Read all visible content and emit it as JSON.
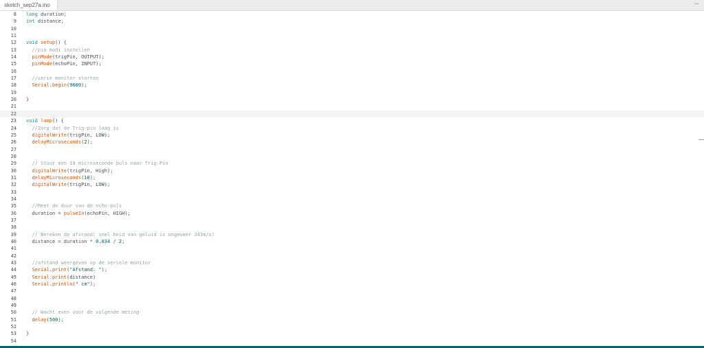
{
  "tab": {
    "filename": "sketch_sep27a.ino",
    "more_icon": "more-horizontal-icon",
    "more_glyph": "···"
  },
  "editor": {
    "current_line": 22,
    "lines": [
      {
        "n": "8",
        "t": [
          [
            "kw",
            "long"
          ],
          [
            "p",
            " duration;"
          ]
        ]
      },
      {
        "n": "9",
        "t": [
          [
            "kw",
            "int"
          ],
          [
            "p",
            " distance;"
          ]
        ]
      },
      {
        "n": "10",
        "t": []
      },
      {
        "n": "11",
        "t": []
      },
      {
        "n": "12",
        "t": [
          [
            "kw",
            "void"
          ],
          [
            "p",
            " "
          ],
          [
            "fn",
            "setup"
          ],
          [
            "p",
            "() {"
          ]
        ]
      },
      {
        "n": "13",
        "t": [
          [
            "p",
            "  "
          ],
          [
            "cm",
            "//pin modi instellen"
          ]
        ]
      },
      {
        "n": "14",
        "t": [
          [
            "p",
            "  "
          ],
          [
            "fn",
            "pinMode"
          ],
          [
            "p",
            "(trigPin, OUTPUT);"
          ]
        ]
      },
      {
        "n": "15",
        "t": [
          [
            "p",
            "  "
          ],
          [
            "fn",
            "pinMode"
          ],
          [
            "p",
            "(echoPin, INPUT);"
          ]
        ]
      },
      {
        "n": "16",
        "t": []
      },
      {
        "n": "17",
        "t": [
          [
            "p",
            "  "
          ],
          [
            "cm",
            "//serie monitor starten"
          ]
        ]
      },
      {
        "n": "18",
        "t": [
          [
            "p",
            "  "
          ],
          [
            "fn",
            "Serial"
          ],
          [
            "p",
            "."
          ],
          [
            "fn",
            "begin"
          ],
          [
            "p",
            "("
          ],
          [
            "num",
            "9600"
          ],
          [
            "p",
            ");"
          ]
        ]
      },
      {
        "n": "19",
        "t": []
      },
      {
        "n": "20",
        "t": [
          [
            "p",
            "}"
          ]
        ]
      },
      {
        "n": "21",
        "t": []
      },
      {
        "n": "22",
        "t": []
      },
      {
        "n": "23",
        "t": [
          [
            "kw",
            "void"
          ],
          [
            "p",
            " "
          ],
          [
            "fn",
            "loop"
          ],
          [
            "p",
            "() {"
          ]
        ]
      },
      {
        "n": "24",
        "t": [
          [
            "p",
            "  "
          ],
          [
            "cm",
            "//Zorg dat de Trig-pin laag is"
          ]
        ]
      },
      {
        "n": "25",
        "t": [
          [
            "p",
            "  "
          ],
          [
            "fn",
            "digitalWrite"
          ],
          [
            "p",
            "(trigPin, LOW);"
          ]
        ]
      },
      {
        "n": "26",
        "t": [
          [
            "p",
            "  "
          ],
          [
            "fn",
            "delayMicroseconds"
          ],
          [
            "p",
            "("
          ],
          [
            "num",
            "2"
          ],
          [
            "p",
            ");"
          ]
        ]
      },
      {
        "n": "27",
        "t": []
      },
      {
        "n": "28",
        "t": []
      },
      {
        "n": "29",
        "t": [
          [
            "p",
            "  "
          ],
          [
            "cm",
            "// Stuur een 10 microseconde puls naar Trig-Pin"
          ]
        ]
      },
      {
        "n": "30",
        "t": [
          [
            "p",
            "  "
          ],
          [
            "fn",
            "digitalWrite"
          ],
          [
            "p",
            "(trigPin, High);"
          ]
        ]
      },
      {
        "n": "31",
        "t": [
          [
            "p",
            "  "
          ],
          [
            "fn",
            "delayMicroseconds"
          ],
          [
            "p",
            "("
          ],
          [
            "num",
            "10"
          ],
          [
            "p",
            ");"
          ]
        ]
      },
      {
        "n": "32",
        "t": [
          [
            "p",
            "  "
          ],
          [
            "fn",
            "digitalWrite"
          ],
          [
            "p",
            "(trigPin, LOW);"
          ]
        ]
      },
      {
        "n": "33",
        "t": []
      },
      {
        "n": "34",
        "t": []
      },
      {
        "n": "35",
        "t": [
          [
            "p",
            "  "
          ],
          [
            "cm",
            "//Meet de duur van de echo-puls"
          ]
        ]
      },
      {
        "n": "36",
        "t": [
          [
            "p",
            "  duration = "
          ],
          [
            "fn",
            "pulseIn"
          ],
          [
            "p",
            "(echoPin, HIGH);"
          ]
        ]
      },
      {
        "n": "37",
        "t": []
      },
      {
        "n": "38",
        "t": []
      },
      {
        "n": "39",
        "t": [
          [
            "p",
            "  "
          ],
          [
            "cm",
            "// Bereken de afstand( snel heid van geluid is ongeveer 343m/s)"
          ]
        ]
      },
      {
        "n": "40",
        "t": [
          [
            "p",
            "  distance = duration * "
          ],
          [
            "num",
            "0.034"
          ],
          [
            "p",
            " / "
          ],
          [
            "num",
            "2"
          ],
          [
            "p",
            ";"
          ]
        ]
      },
      {
        "n": "41",
        "t": []
      },
      {
        "n": "42",
        "t": []
      },
      {
        "n": "43",
        "t": [
          [
            "p",
            "  "
          ],
          [
            "cm",
            "//afstand weergeven op de seriele monitor"
          ]
        ]
      },
      {
        "n": "44",
        "t": [
          [
            "p",
            "  "
          ],
          [
            "fn",
            "Serial"
          ],
          [
            "p",
            "."
          ],
          [
            "fn",
            "print"
          ],
          [
            "p",
            "("
          ],
          [
            "str",
            "\"Afstand: \""
          ],
          [
            "p",
            ");"
          ]
        ]
      },
      {
        "n": "45",
        "t": [
          [
            "p",
            "  "
          ],
          [
            "fn",
            "Serial"
          ],
          [
            "p",
            "."
          ],
          [
            "fn",
            "print"
          ],
          [
            "p",
            "(distance)"
          ]
        ]
      },
      {
        "n": "46",
        "t": [
          [
            "p",
            "  "
          ],
          [
            "fn",
            "Serial"
          ],
          [
            "p",
            "."
          ],
          [
            "fn",
            "println"
          ],
          [
            "p",
            "("
          ],
          [
            "str",
            "\" cm\""
          ],
          [
            "p",
            ");"
          ]
        ]
      },
      {
        "n": "47",
        "t": []
      },
      {
        "n": "48",
        "t": []
      },
      {
        "n": "49",
        "t": []
      },
      {
        "n": "50",
        "t": [
          [
            "p",
            "  "
          ],
          [
            "cm",
            "// Wacht even voor de volgende meting"
          ]
        ]
      },
      {
        "n": "51",
        "t": [
          [
            "p",
            "  "
          ],
          [
            "fn",
            "delay"
          ],
          [
            "p",
            "("
          ],
          [
            "num",
            "500"
          ],
          [
            "p",
            ");"
          ]
        ]
      },
      {
        "n": "52",
        "t": []
      },
      {
        "n": "53",
        "t": [
          [
            "p",
            "}"
          ]
        ]
      },
      {
        "n": "54",
        "t": []
      }
    ]
  },
  "colors": {
    "keyword": "#00979c",
    "function": "#d35400",
    "comment": "#95a5a6",
    "number": "#005c5f",
    "plain": "#434f54",
    "status_bar": "#006468"
  }
}
